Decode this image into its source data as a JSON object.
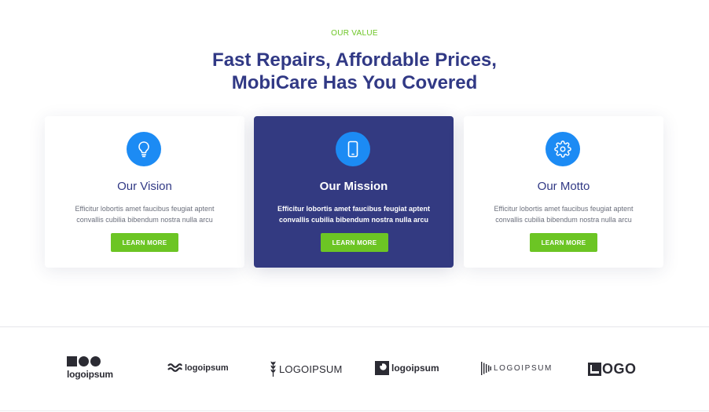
{
  "section": {
    "eyebrow": "OUR VALUE",
    "headline_line1": "Fast Repairs, Affordable Prices,",
    "headline_line2": "MobiCare Has You Covered"
  },
  "cards": [
    {
      "icon": "lightbulb-icon",
      "title": "Our Vision",
      "desc_line1": "Efficitur lobortis amet faucibus feugiat aptent",
      "desc_line2": "convallis cubilia bibendum nostra nulla arcu",
      "button": "LEARN MORE"
    },
    {
      "icon": "smartphone-icon",
      "title": "Our Mission",
      "desc_line1": "Efficitur lobortis amet faucibus feugiat aptent",
      "desc_line2": "convallis cubilia bibendum nostra nulla arcu",
      "button": "LEARN MORE"
    },
    {
      "icon": "gear-icon",
      "title": "Our Motto",
      "desc_line1": "Efficitur lobortis amet faucibus feugiat aptent",
      "desc_line2": "convallis cubilia bibendum nostra nulla arcu",
      "button": "LEARN MORE"
    }
  ],
  "logos": {
    "logo1": "logoipsum",
    "logo2": "logoipsum",
    "logo3": "LOGOIPSUM",
    "logo4": "logoipsum",
    "logo5": "LOGOIPSUM",
    "logo6": "OGO"
  },
  "colors": {
    "accent_green": "#6cc524",
    "navy": "#313985",
    "card_active": "#333a81",
    "icon_blue": "#1c8bf4"
  }
}
